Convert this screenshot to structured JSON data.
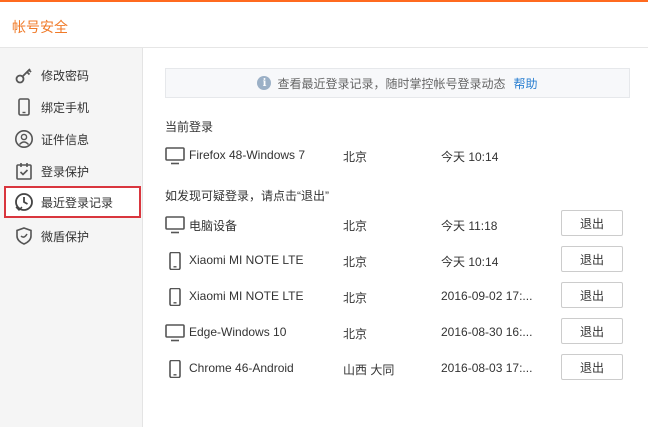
{
  "header": {
    "title": "帐号安全"
  },
  "sidebar": {
    "items": [
      {
        "label": "修改密码",
        "icon": "key-icon"
      },
      {
        "label": "绑定手机",
        "icon": "phone-icon"
      },
      {
        "label": "证件信息",
        "icon": "id-card-icon"
      },
      {
        "label": "登录保护",
        "icon": "login-protect-icon"
      },
      {
        "label": "最近登录记录",
        "icon": "clock-icon",
        "active": true
      },
      {
        "label": "微盾保护",
        "icon": "shield-icon"
      }
    ]
  },
  "notice": {
    "text": "查看最近登录记录，随时掌控帐号登录动态",
    "help": "帮助",
    "icon": "info-icon"
  },
  "current": {
    "title": "当前登录",
    "row": {
      "device_type": "monitor",
      "name": "Firefox 48-Windows 7",
      "location": "北京",
      "time": "今天 10:14"
    }
  },
  "others": {
    "title": "如发现可疑登录，请点击“退出”",
    "logout_label": "退出",
    "rows": [
      {
        "device_type": "monitor",
        "name": "电脑设备",
        "location": "北京",
        "time": "今天 11:18"
      },
      {
        "device_type": "phone",
        "name": "Xiaomi MI NOTE LTE",
        "location": "北京",
        "time": "今天 10:14"
      },
      {
        "device_type": "phone",
        "name": "Xiaomi MI NOTE LTE",
        "location": "北京",
        "time": "2016-09-02 17:..."
      },
      {
        "device_type": "monitor",
        "name": "Edge-Windows 10",
        "location": "北京",
        "time": "2016-08-30 16:..."
      },
      {
        "device_type": "phone",
        "name": "Chrome 46-Android",
        "location": "山西 大同",
        "time": "2016-08-03 17:..."
      }
    ]
  },
  "colors": {
    "accent": "#f07a28",
    "active_border": "#d9363e",
    "link": "#2a7fd1"
  }
}
